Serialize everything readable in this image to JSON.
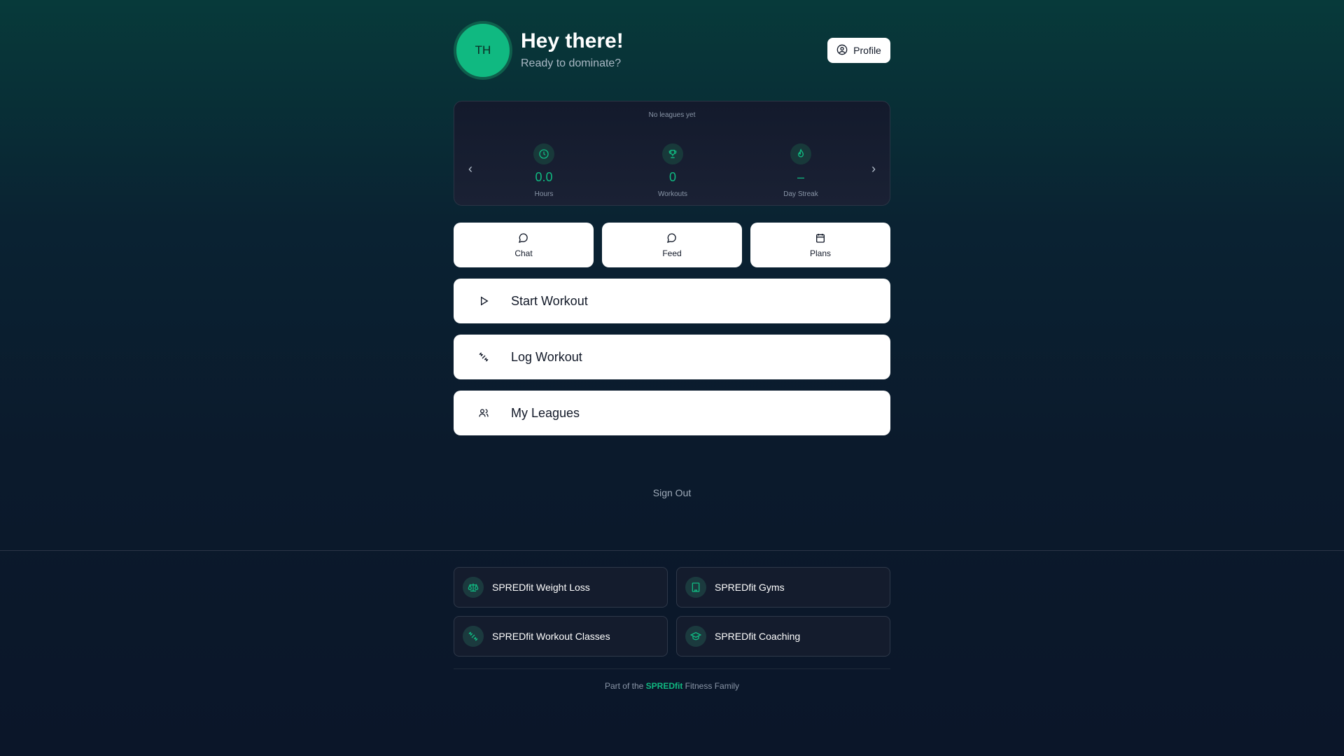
{
  "header": {
    "avatar_initials": "TH",
    "greeting": "Hey there!",
    "subtitle": "Ready to dominate?",
    "profile_label": "Profile"
  },
  "stats": {
    "title": "No leagues yet",
    "items": [
      {
        "icon": "clock-icon",
        "value": "0.0",
        "label": "Hours"
      },
      {
        "icon": "trophy-icon",
        "value": "0",
        "label": "Workouts"
      },
      {
        "icon": "flame-icon",
        "value": "–",
        "label": "Day Streak"
      }
    ],
    "prev_arrow": "‹",
    "next_arrow": "›"
  },
  "quick_actions": [
    {
      "icon": "chat-bubble-icon",
      "label": "Chat"
    },
    {
      "icon": "chat-bubble-icon",
      "label": "Feed"
    },
    {
      "icon": "calendar-icon",
      "label": "Plans"
    }
  ],
  "actions": [
    {
      "icon": "play-icon",
      "label": "Start Workout"
    },
    {
      "icon": "dumbbell-icon",
      "label": "Log Workout"
    },
    {
      "icon": "users-icon",
      "label": "My Leagues"
    }
  ],
  "sign_out": "Sign Out",
  "family": [
    {
      "icon": "scale-icon",
      "label": "SPREDfit Weight Loss"
    },
    {
      "icon": "building-icon",
      "label": "SPREDfit Gyms"
    },
    {
      "icon": "dumbbell-icon",
      "label": "SPREDfit Workout Classes"
    },
    {
      "icon": "graduation-cap-icon",
      "label": "SPREDfit Coaching"
    }
  ],
  "footer": {
    "prefix": "Part of the ",
    "brand": "SPREDfit",
    "suffix": " Fitness Family"
  },
  "colors": {
    "accent": "#10b981",
    "background_top": "#073a3a",
    "background_bottom": "#0b1629"
  }
}
